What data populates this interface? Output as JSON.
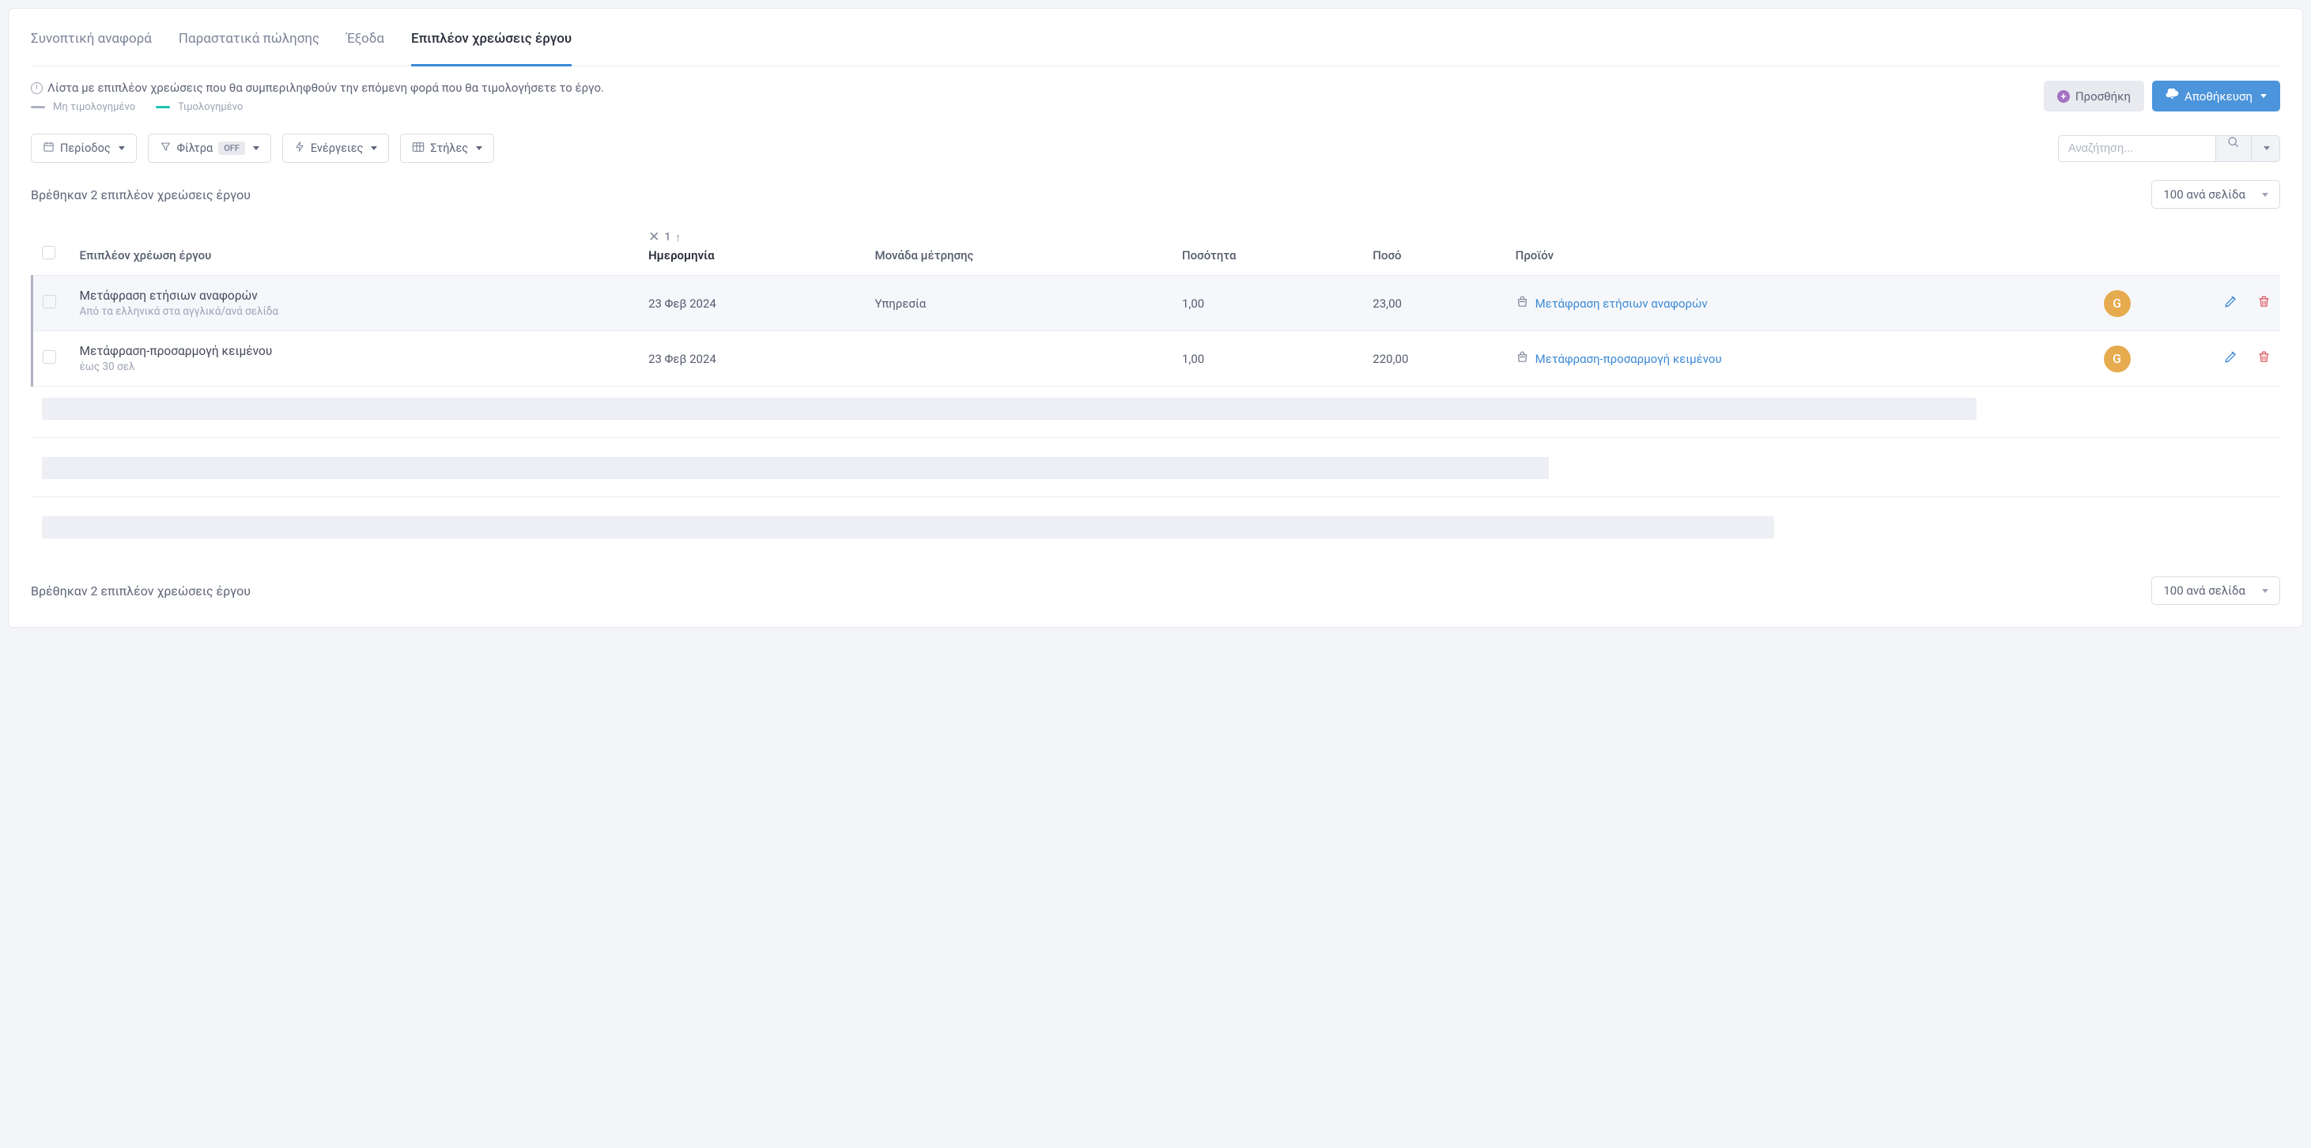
{
  "tabs": [
    {
      "label": "Συνοπτική αναφορά",
      "active": false
    },
    {
      "label": "Παραστατικά πώλησης",
      "active": false
    },
    {
      "label": "Έξοδα",
      "active": false
    },
    {
      "label": "Επιπλέον χρεώσεις έργου",
      "active": true
    }
  ],
  "info_text": "Λίστα με επιπλέον χρεώσεις που θα συμπεριληφθούν την επόμενη φορά που θα τιμολογήσετε το έργο.",
  "legend": {
    "not_invoiced": "Μη τιμολογημένο",
    "invoiced": "Τιμολογημένο"
  },
  "buttons": {
    "add": "Προσθήκη",
    "save": "Αποθήκευση"
  },
  "toolbar": {
    "period": "Περίοδος",
    "filters": "Φίλτρα",
    "filters_badge": "OFF",
    "actions": "Ενέργειες",
    "columns": "Στήλες"
  },
  "search": {
    "placeholder": "Αναζήτηση..."
  },
  "results_text": "Βρέθηκαν 2 επιπλέον χρεώσεις έργου",
  "page_select": "100 ανά σελίδα",
  "sort": {
    "number": "1"
  },
  "columns": {
    "charge": "Επιπλέον χρέωση έργου",
    "date": "Ημερομηνία",
    "unit": "Μονάδα μέτρησης",
    "quantity": "Ποσότητα",
    "amount": "Ποσό",
    "product": "Προϊόν"
  },
  "rows": [
    {
      "title": "Μετάφραση ετήσιων αναφορών",
      "subtitle": "Από τα ελληνικά στα αγγλικά/ανά σελίδα",
      "date": "23 Φεβ 2024",
      "unit": "Υπηρεσία",
      "qty": "1,00",
      "amount": "23,00",
      "product": "Μετάφραση ετήσιων αναφορών",
      "avatar": "G"
    },
    {
      "title": "Μετάφραση-προσαρμογή κειμένου",
      "subtitle": "έως 30 σελ",
      "date": "23 Φεβ 2024",
      "unit": "",
      "qty": "1,00",
      "amount": "220,00",
      "product": "Μετάφραση-προσαρμογή κειμένου",
      "avatar": "G"
    }
  ],
  "footer_results_text": "Βρέθηκαν 2 επιπλέον χρεώσεις έργου"
}
